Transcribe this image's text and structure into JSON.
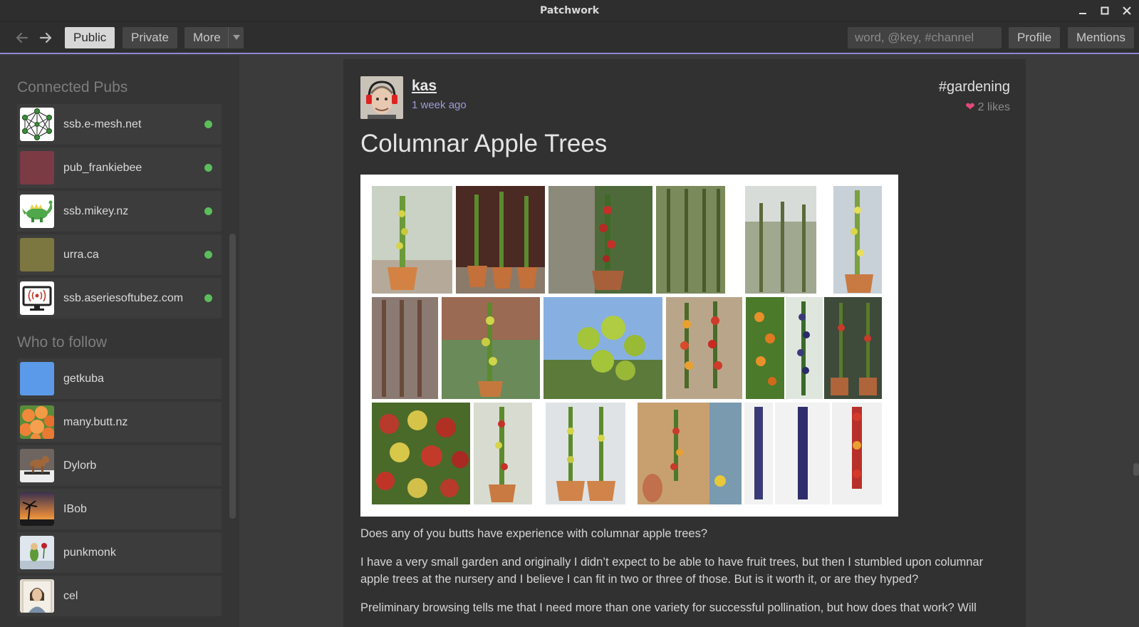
{
  "window": {
    "title": "Patchwork"
  },
  "toolbar": {
    "public_label": "Public",
    "private_label": "Private",
    "more_label": "More",
    "search_placeholder": "word, @key, #channel",
    "profile_label": "Profile",
    "mentions_label": "Mentions"
  },
  "sidebar": {
    "pubs_title": "Connected Pubs",
    "pubs": [
      {
        "name": "ssb.e-mesh.net",
        "icon": "mesh-network-icon",
        "online": true
      },
      {
        "name": "pub_frankiebee",
        "icon": "color-avatar",
        "color": "#7b3b44",
        "online": true
      },
      {
        "name": "ssb.mikey.nz",
        "icon": "green-dinosaur-icon",
        "online": true
      },
      {
        "name": "urra.ca",
        "icon": "color-avatar",
        "color": "#7c7640",
        "online": true
      },
      {
        "name": "ssb.aseriesoftubez.com",
        "icon": "monitor-broadcast-icon",
        "online": true
      }
    ],
    "follow_title": "Who to follow",
    "follow": [
      {
        "name": "getkuba",
        "icon": "color-avatar",
        "color": "#5b9ae8"
      },
      {
        "name": "many.butt.nz",
        "icon": "peaches-avatar"
      },
      {
        "name": "Dylorb",
        "icon": "dog-avatar"
      },
      {
        "name": "IBob",
        "icon": "sunset-palm-avatar"
      },
      {
        "name": "punkmonk",
        "icon": "rose-avatar"
      },
      {
        "name": "cel",
        "icon": "portrait-avatar"
      }
    ]
  },
  "post": {
    "author": "kas",
    "time": "1 week ago",
    "channel": "#gardening",
    "likes": "2 likes",
    "title": "Columnar Apple Trees",
    "paragraphs": [
      "Does any of you butts have experience with columnar apple trees?",
      "I have a very small garden and originally I didn’t expect to be able to have fruit trees, but then I stumbled upon columnar apple trees at the nursery and I believe I can fit in two or three of those. But is it worth it, or are they hyped?",
      "Preliminary browsing tells me that I need more than one variety for successful pollination, but how does that work? Will"
    ]
  },
  "colors": {
    "accent": "#8e86d8",
    "online": "#5bbd5b",
    "heart": "#e34a7a"
  }
}
